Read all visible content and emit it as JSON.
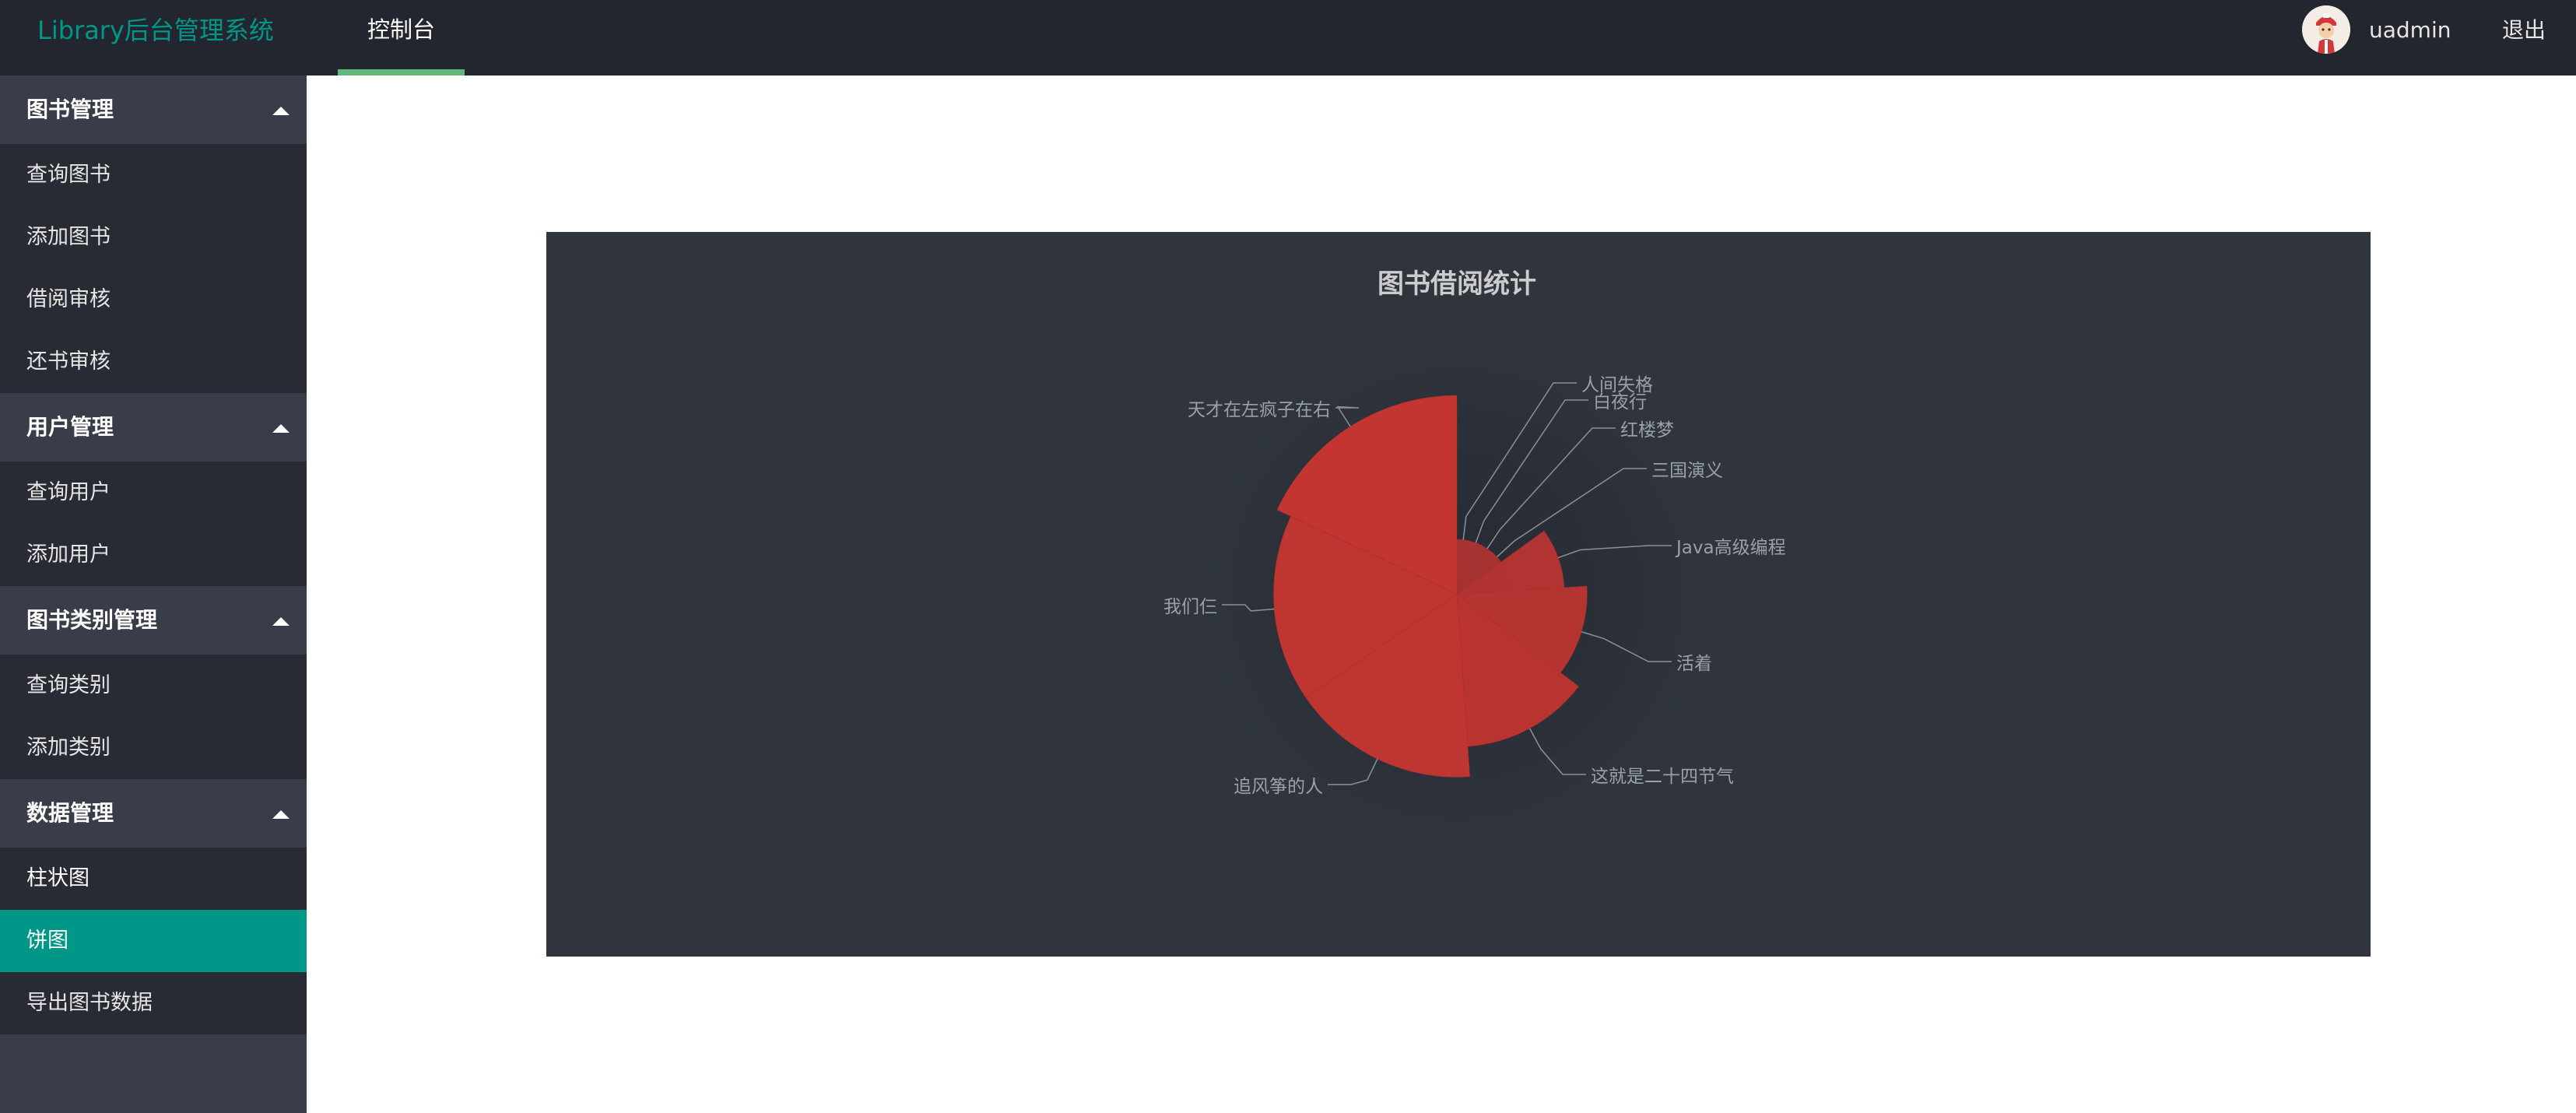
{
  "header": {
    "logo": "Library后台管理系统",
    "nav_tab": "控制台",
    "username": "uadmin",
    "logout": "退出"
  },
  "sidebar": {
    "groups": [
      {
        "label": "图书管理",
        "items": [
          "查询图书",
          "添加图书",
          "借阅审核",
          "还书审核"
        ]
      },
      {
        "label": "用户管理",
        "items": [
          "查询用户",
          "添加用户"
        ]
      },
      {
        "label": "图书类别管理",
        "items": [
          "查询类别",
          "添加类别"
        ]
      },
      {
        "label": "数据管理",
        "items": [
          "柱状图",
          "饼图",
          "导出图书数据"
        ]
      }
    ],
    "active_item": "饼图"
  },
  "colors": {
    "header_bg": "#23262e",
    "sidebar_bg": "#393d49",
    "accent": "#009688",
    "tab_underline": "#5fb878",
    "chart_bg": "#2f343d",
    "slice": "#c23531"
  },
  "chart_data": {
    "type": "pie",
    "subtype": "nightingale-rose",
    "title": "图书借阅统计",
    "slices": [
      {
        "name": "人间失格",
        "value": 5
      },
      {
        "name": "白夜行",
        "value": 5
      },
      {
        "name": "红楼梦",
        "value": 5
      },
      {
        "name": "三国演义",
        "value": 5
      },
      {
        "name": "Java高级编程",
        "value": 12
      },
      {
        "name": "活着",
        "value": 15
      },
      {
        "name": "这就是二十四节气",
        "value": 18
      },
      {
        "name": "追风筝的人",
        "value": 22
      },
      {
        "name": "我们仨",
        "value": 22
      },
      {
        "name": "天才在左疯子在右",
        "value": 24
      }
    ],
    "color": "#c23531"
  }
}
